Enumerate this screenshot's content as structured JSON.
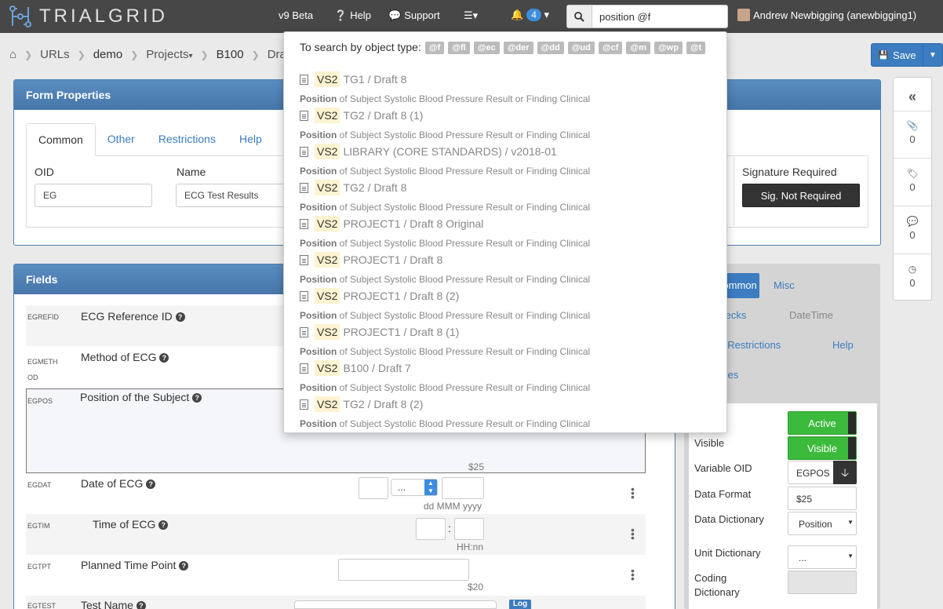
{
  "nav": {
    "brand": "TRIALGRID",
    "beta": "v9 Beta",
    "help": "Help",
    "support": "Support",
    "notifications": "4",
    "search_value": "position @f",
    "user": "Andrew Newbigging (anewbigging1)"
  },
  "breadcrumb": [
    "URLs",
    "demo",
    "Projects",
    "B100",
    "Dra"
  ],
  "save_label": "Save",
  "form_properties": {
    "title": "Form Properties",
    "tabs": [
      "Common",
      "Other",
      "Restrictions",
      "Help"
    ],
    "oid_label": "OID",
    "oid_value": "EG",
    "name_label": "Name",
    "name_value": "ECG Test Results",
    "sig_label": "Signature Required",
    "sig_value": "Sig. Not Required"
  },
  "fields": {
    "title": "Fields",
    "rows": [
      {
        "oid": "EGREFID",
        "label": "ECG Reference ID"
      },
      {
        "oid": "EGMETH\nOD",
        "label": "Method of ECG"
      },
      {
        "oid": "EGPOS",
        "label": "Position of the Subject",
        "format": "$25"
      },
      {
        "oid": "EGDAT",
        "label": "Date of ECG",
        "select": "...",
        "hint": "dd MMM yyyy"
      },
      {
        "oid": "EGTIM",
        "label": "Time of ECG",
        "colon": ":",
        "hint": "HH:nn"
      },
      {
        "oid": "EGTPT",
        "label": "Planned Time Point",
        "format": "$20"
      },
      {
        "oid": "EGTEST",
        "label": "Test Name",
        "btn": "Log"
      }
    ]
  },
  "sidebar": {
    "counts": [
      "0",
      "0",
      "0",
      "0"
    ]
  },
  "field_props": {
    "tabs": [
      "Common",
      "Misc"
    ],
    "links": [
      "Edit Checks",
      "DateTime",
      "Views / Restrictions",
      "Help",
      "Properties"
    ],
    "active_btn": "Active",
    "visible_label": "Visible",
    "visible_btn": "Visible",
    "varoid_label": "Variable OID",
    "varoid_value": "EGPOS",
    "format_label": "Data Format",
    "format_value": "$25",
    "datadict_label": "Data Dictionary",
    "datadict_value": "Position",
    "unitdict_label": "Unit Dictionary",
    "unitdict_value": "...",
    "coding_label": "Coding Dictionary"
  },
  "dropdown": {
    "header": "To search by object type:",
    "chips": [
      "@f",
      "@fl",
      "@ec",
      "@der",
      "@dd",
      "@ud",
      "@cf",
      "@m",
      "@wp",
      "@t"
    ],
    "items": [
      {
        "tag": "VS2",
        "path": "TG1 / Draft 8",
        "match": "Position",
        "desc": " of Subject Systolic Blood Pressure Result or Finding Clinical"
      },
      {
        "tag": "VS2",
        "path": "TG2 / Draft 8 (1)",
        "match": "Position",
        "desc": " of Subject Systolic Blood Pressure Result or Finding Clinical"
      },
      {
        "tag": "VS2",
        "path": "LIBRARY (CORE STANDARDS) / v2018-01",
        "match": "Position",
        "desc": " of Subject Systolic Blood Pressure Result or Finding Clinical"
      },
      {
        "tag": "VS2",
        "path": "TG2 / Draft 8",
        "match": "Position",
        "desc": " of Subject Systolic Blood Pressure Result or Finding Clinical"
      },
      {
        "tag": "VS2",
        "path": "PROJECT1 / Draft 8 Original",
        "match": "Position",
        "desc": " of Subject Systolic Blood Pressure Result or Finding Clinical"
      },
      {
        "tag": "VS2",
        "path": "PROJECT1 / Draft 8",
        "match": "Position",
        "desc": " of Subject Systolic Blood Pressure Result or Finding Clinical"
      },
      {
        "tag": "VS2",
        "path": "PROJECT1 / Draft 8 (2)",
        "match": "Position",
        "desc": " of Subject Systolic Blood Pressure Result or Finding Clinical"
      },
      {
        "tag": "VS2",
        "path": "PROJECT1 / Draft 8 (1)",
        "match": "Position",
        "desc": " of Subject Systolic Blood Pressure Result or Finding Clinical"
      },
      {
        "tag": "VS2",
        "path": "B100 / Draft 7",
        "match": "Position",
        "desc": " of Subject Systolic Blood Pressure Result or Finding Clinical"
      },
      {
        "tag": "VS2",
        "path": "TG2 / Draft 8 (2)",
        "match": "Position",
        "desc": " of Subject Systolic Blood Pressure Result or Finding Clinical"
      }
    ]
  }
}
